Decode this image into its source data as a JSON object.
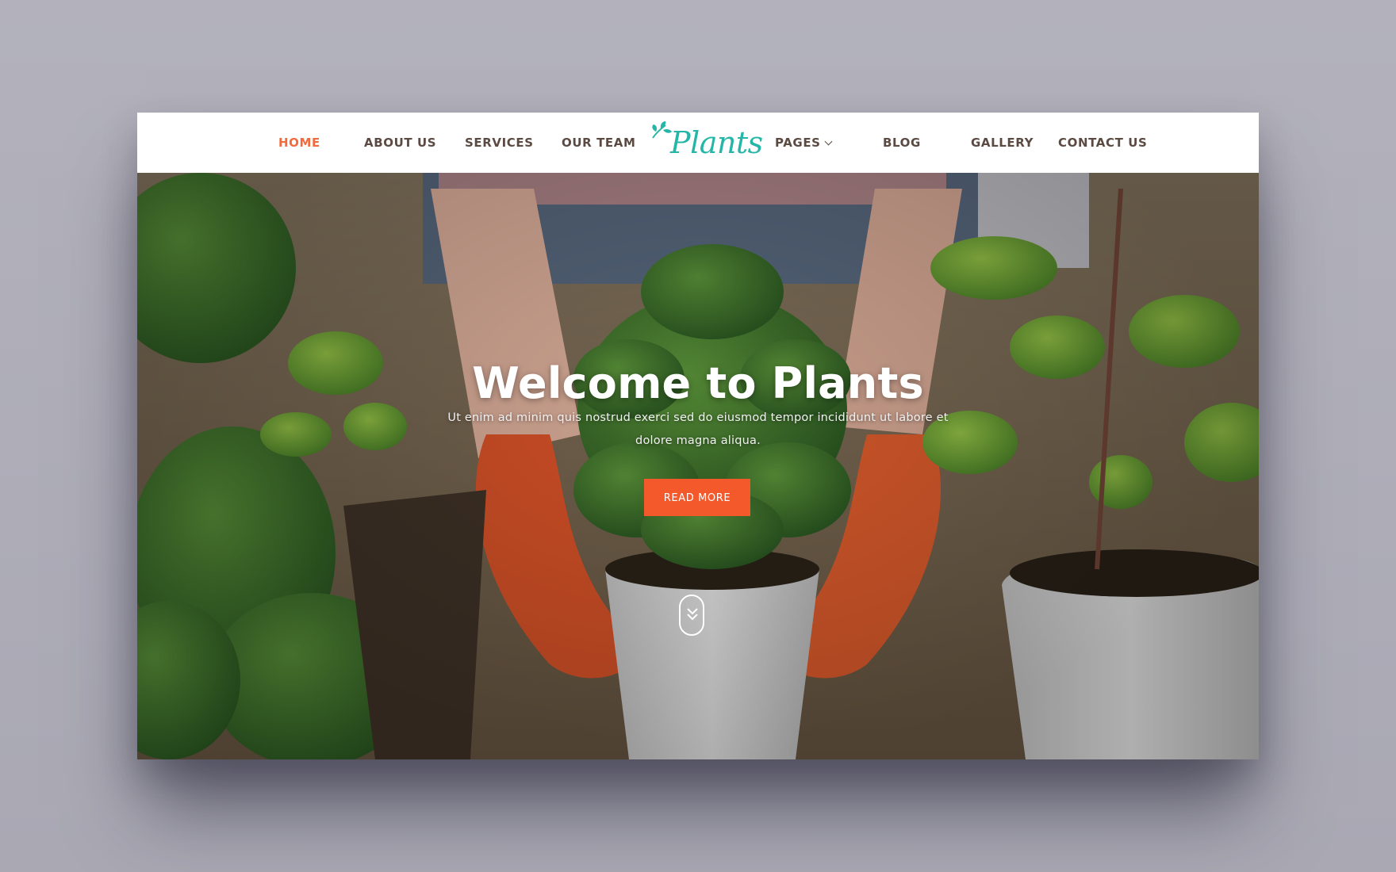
{
  "navbar": {
    "items": [
      {
        "label": "HOME",
        "active": true
      },
      {
        "label": "ABOUT US"
      },
      {
        "label": "SERVICES"
      },
      {
        "label": "OUR TEAM"
      },
      {
        "label": "PAGES",
        "has_dropdown": true
      },
      {
        "label": "BLOG"
      },
      {
        "label": "GALLERY"
      },
      {
        "label": "CONTACT US"
      }
    ],
    "logo": {
      "text": "Plants",
      "icon": "leaf-icon"
    }
  },
  "hero": {
    "title": "Welcome to Plants",
    "subtitle": "Ut enim ad minim quis nostrud exerci sed do eiusmod tempor incididunt ut labore et dolore magna aliqua.",
    "button_label": "READ MORE",
    "scroll_icon": "double-chevron-down-icon"
  },
  "colors": {
    "accent": "#f4592c",
    "active_nav": "#f26a3d",
    "logo": "#26b6a8",
    "nav_text": "#5b4a42"
  }
}
